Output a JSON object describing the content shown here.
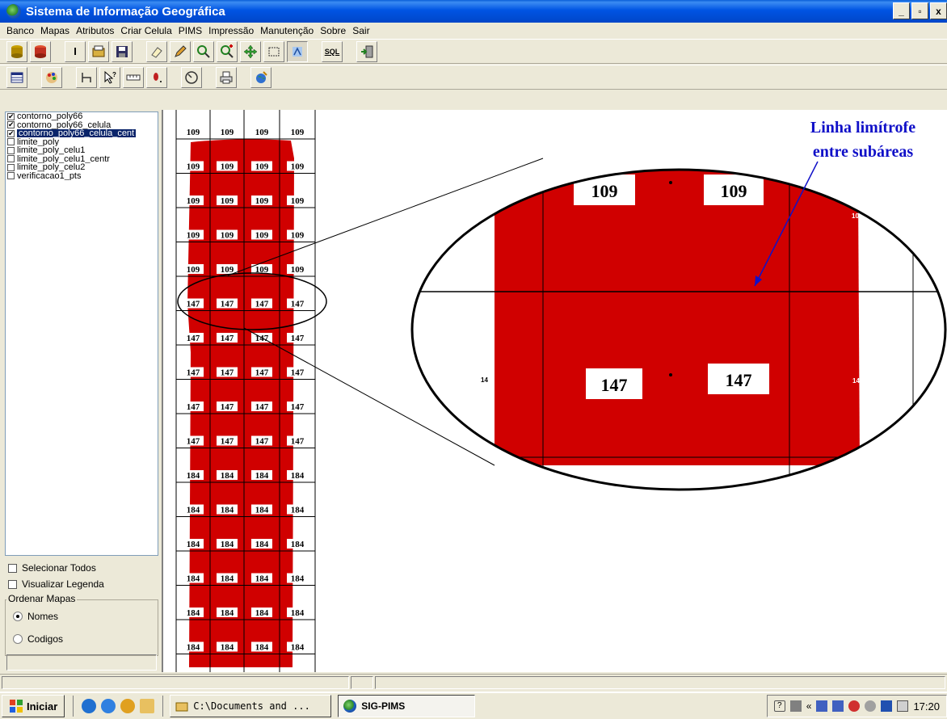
{
  "window": {
    "title": "Sistema de Informação Geográfica",
    "min": "_",
    "max": "▫",
    "close": "x"
  },
  "menu": [
    "Banco",
    "Mapas",
    "Atributos",
    "Criar Celula",
    "PIMS",
    "Impressão",
    "Manutenção",
    "Sobre",
    "Sair"
  ],
  "toolbar1": {
    "text_tool": "I",
    "sql": "SQL"
  },
  "layers": [
    {
      "label": "contorno_poly66",
      "checked": true,
      "selected": false
    },
    {
      "label": "contorno_poly66_celula",
      "checked": true,
      "selected": false
    },
    {
      "label": "contorno_poly66_celula_cent",
      "checked": true,
      "selected": true
    },
    {
      "label": "limite_poly",
      "checked": false,
      "selected": false
    },
    {
      "label": "limite_poly_celu1",
      "checked": false,
      "selected": false
    },
    {
      "label": "limite_poly_celu1_centr",
      "checked": false,
      "selected": false
    },
    {
      "label": "limite_poly_celu2",
      "checked": false,
      "selected": false
    },
    {
      "label": "verificacao1_pts",
      "checked": false,
      "selected": false
    }
  ],
  "options": {
    "select_all": "Selecionar Todos",
    "show_legend": "Visualizar Legenda",
    "order_group": "Ordenar Mapas",
    "by_names": "Nomes",
    "by_codes": "Codigos"
  },
  "map": {
    "annotation_line1": "Linha limítrofe",
    "annotation_line2": "entre subáreas",
    "zoom_top_left": "109",
    "zoom_top_right": "109",
    "zoom_bottom_left": "147",
    "zoom_bottom_right": "147",
    "zoom_edge_top": "10",
    "zoom_edge_left": "14",
    "zoom_edge_right": "14",
    "grid_rows": [
      [
        "109",
        "109",
        "109",
        "109"
      ],
      [
        "109",
        "109",
        "109",
        "109"
      ],
      [
        "109",
        "109",
        "109",
        "109"
      ],
      [
        "109",
        "109",
        "109",
        "109"
      ],
      [
        "109",
        "109",
        "109",
        "109"
      ],
      [
        "147",
        "147",
        "147",
        "147"
      ],
      [
        "147",
        "147",
        "147",
        "147"
      ],
      [
        "147",
        "147",
        "147",
        "147"
      ],
      [
        "147",
        "147",
        "147",
        "147"
      ],
      [
        "147",
        "147",
        "147",
        "147"
      ],
      [
        "184",
        "184",
        "184",
        "184"
      ],
      [
        "184",
        "184",
        "184",
        "184"
      ],
      [
        "184",
        "184",
        "184",
        "184"
      ],
      [
        "184",
        "184",
        "184",
        "184"
      ],
      [
        "184",
        "184",
        "184",
        "184"
      ],
      [
        "184",
        "184",
        "184",
        "184"
      ]
    ],
    "fill_color": "#d00000",
    "annotation_color": "#1010c8"
  },
  "taskbar": {
    "start": "Iniciar",
    "task1": "C:\\Documents and ...",
    "task2": "SIG-PIMS",
    "clock": "17:20"
  }
}
